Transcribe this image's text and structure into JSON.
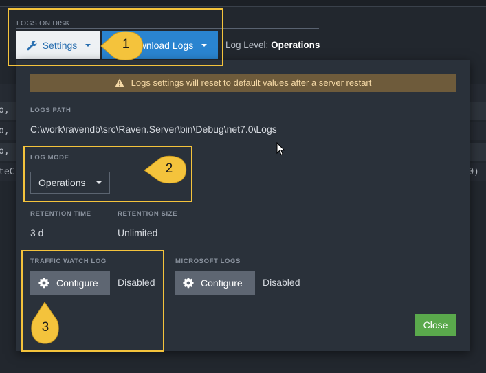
{
  "section": {
    "title": "LOGS ON DISK"
  },
  "toolbar": {
    "settings_label": "Settings",
    "download_label": "Download Logs",
    "download_visible_label": "ownload Logs",
    "log_level_label": "Log Level:",
    "log_level_value": "Operations"
  },
  "background_log": {
    "rows": [
      {
        "left": "o, (",
        "right": ""
      },
      {
        "left": "o, (",
        "right": ""
      },
      {
        "left": "o, (",
        "right": ""
      },
      {
        "left": "teC",
        "right": "0)"
      }
    ]
  },
  "panel": {
    "warning": "Logs settings will reset to default values after a server restart",
    "logs_path_label": "LOGS PATH",
    "logs_path_value": "C:\\work\\ravendb\\src\\Raven.Server\\bin\\Debug\\net7.0\\Logs",
    "log_mode_label": "LOG MODE",
    "log_mode_value": "Operations",
    "retention_time_label": "RETENTION TIME",
    "retention_time_value": "3 d",
    "retention_size_label": "RETENTION SIZE",
    "retention_size_value": "Unlimited",
    "traffic_watch_label": "TRAFFIC WATCH LOG",
    "traffic_watch_button": "Configure",
    "traffic_watch_status": "Disabled",
    "microsoft_logs_label": "MICROSOFT LOGS",
    "microsoft_logs_button": "Configure",
    "microsoft_logs_status": "Disabled",
    "close_label": "Close"
  },
  "callouts": [
    {
      "number": "1"
    },
    {
      "number": "2"
    },
    {
      "number": "3"
    }
  ],
  "icons": {
    "settings": "wrench-icon",
    "warning": "warning-icon",
    "configure": "gear-icon",
    "cursor": "mouse-cursor-icon"
  },
  "colors": {
    "accent_blue": "#2a84d0",
    "close_green": "#5aa94c",
    "callout_yellow": "#f4c33c",
    "warning_bg": "#6e5b3b",
    "panel_bg": "#2a313a"
  }
}
